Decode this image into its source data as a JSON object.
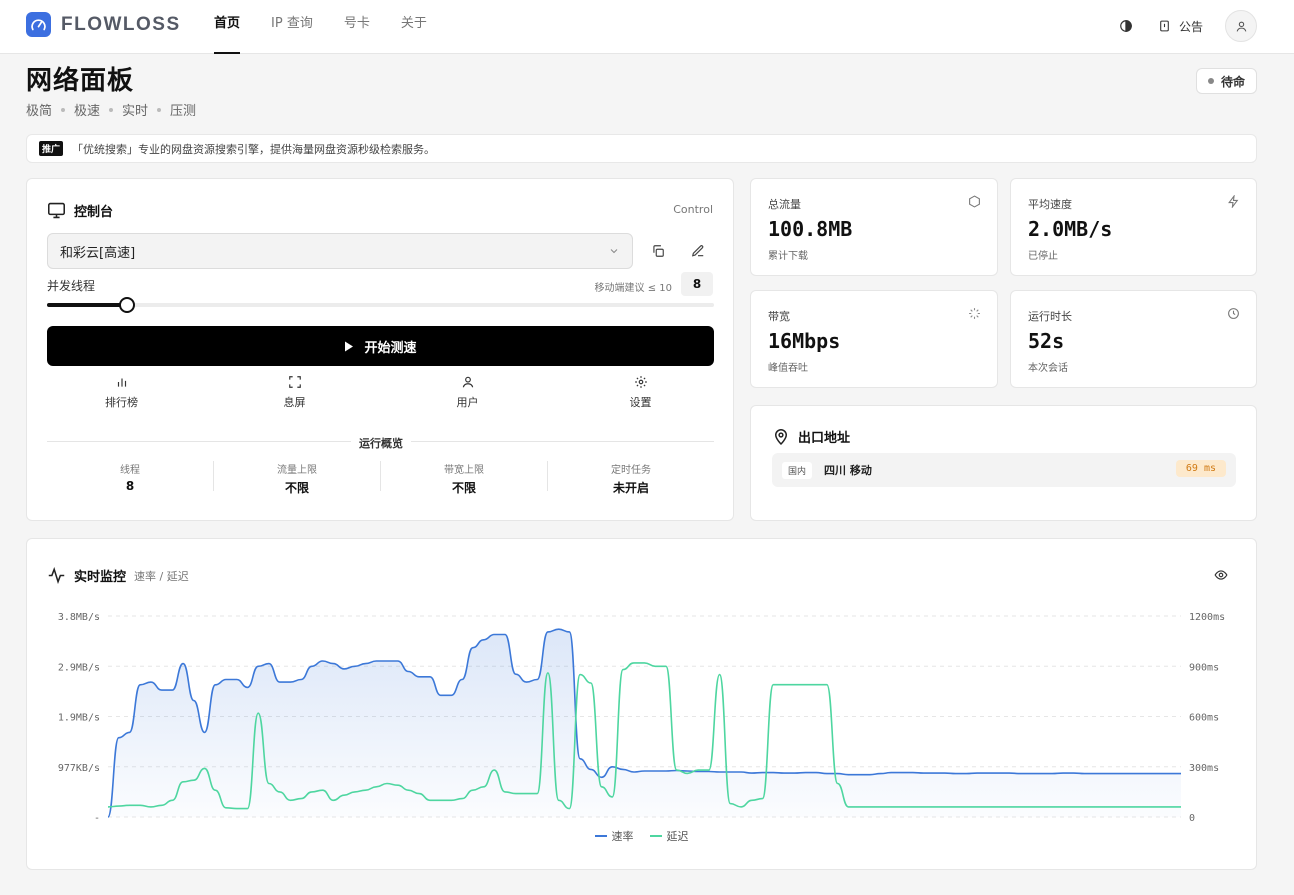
{
  "header": {
    "logo_text": "FLOWLOSS",
    "nav": [
      {
        "label": "首页",
        "active": true
      },
      {
        "label": "IP 查询",
        "active": false
      },
      {
        "label": "号卡",
        "active": false
      },
      {
        "label": "关于",
        "active": false
      }
    ],
    "notice_label": "公告"
  },
  "page": {
    "title": "网络面板",
    "tags": [
      "极简",
      "极速",
      "实时",
      "压测"
    ],
    "status": "待命"
  },
  "ad": {
    "badge": "推广",
    "text": "「优统搜索」专业的网盘资源搜索引擎，提供海量网盘资源秒级检索服务。"
  },
  "control": {
    "title": "控制台",
    "subtitle": "Control",
    "selected_node": "和彩云[高速]",
    "threads_label": "并发线程",
    "threads_hint": "移动端建议 ≤ 10",
    "threads_value": "8",
    "threads_fraction": 0.12,
    "start_label": "开始测速",
    "actions": [
      {
        "label": "排行榜",
        "icon": "chart-bars-icon"
      },
      {
        "label": "息屏",
        "icon": "fullscreen-icon"
      },
      {
        "label": "用户",
        "icon": "user-icon"
      },
      {
        "label": "设置",
        "icon": "gear-icon"
      }
    ],
    "overview_title": "运行概览",
    "overview": [
      {
        "label": "线程",
        "value": "8"
      },
      {
        "label": "流量上限",
        "value": "不限"
      },
      {
        "label": "带宽上限",
        "value": "不限"
      },
      {
        "label": "定时任务",
        "value": "未开启"
      }
    ]
  },
  "stats": [
    {
      "label": "总流量",
      "value": "100.8MB",
      "sub": "累计下载",
      "icon": "hexagon-icon"
    },
    {
      "label": "平均速度",
      "value": "2.0MB/s",
      "sub": "已停止",
      "icon": "lightning-icon"
    },
    {
      "label": "带宽",
      "value": "16Mbps",
      "sub": "峰值吞吐",
      "icon": "loader-icon"
    },
    {
      "label": "运行时长",
      "value": "52s",
      "sub": "本次会话",
      "icon": "clock-icon"
    }
  ],
  "exit": {
    "title": "出口地址",
    "region_chip": "国内",
    "location": "四川 移动",
    "latency": "69 ms"
  },
  "monitor": {
    "title": "实时监控",
    "subtitle": "速率 / 延迟",
    "legend": [
      {
        "label": "速率",
        "color": "#3c78d8"
      },
      {
        "label": "延迟",
        "color": "#4ed6a0"
      }
    ]
  },
  "chart_data": {
    "type": "line",
    "y_left_ticks": [
      "3.8MB/s",
      "2.9MB/s",
      "1.9MB/s",
      "977KB/s",
      "-"
    ],
    "y_right_ticks": [
      "1200ms",
      "900ms",
      "600ms",
      "300ms",
      "0"
    ],
    "ylim_left_MBps": [
      0,
      3.8
    ],
    "ylim_right_ms": [
      0,
      1200
    ],
    "grid": true,
    "legend_position": "bottom",
    "x": [
      0,
      1,
      2,
      3,
      4,
      5,
      6,
      7,
      8,
      9,
      10,
      11,
      12,
      13,
      14,
      15,
      16,
      17,
      18,
      19,
      20,
      21,
      22,
      23,
      24,
      25,
      26,
      27,
      28,
      29,
      30,
      31,
      32,
      33,
      34,
      35,
      36,
      37,
      38,
      39,
      40,
      41,
      42,
      43,
      44,
      45,
      46,
      47,
      48,
      49,
      50,
      51,
      52,
      53,
      54,
      55,
      56,
      57,
      58,
      59,
      60,
      61,
      62,
      63,
      64,
      65,
      66,
      67,
      68,
      69,
      70,
      71,
      72,
      73,
      74,
      75,
      76,
      77,
      78,
      79,
      80,
      81,
      82,
      83,
      84,
      85,
      86,
      87,
      88,
      89,
      90,
      91,
      92,
      93,
      94,
      95,
      96,
      97,
      98,
      99,
      100
    ],
    "series": [
      {
        "name": "速率",
        "unit": "MB/s",
        "values": [
          0,
          1.5,
          1.6,
          2.5,
          2.55,
          2.4,
          2.4,
          2.9,
          2.2,
          1.6,
          2.5,
          2.6,
          2.6,
          2.45,
          2.85,
          2.9,
          2.55,
          2.55,
          2.6,
          2.85,
          2.95,
          2.9,
          2.8,
          2.85,
          2.9,
          2.95,
          2.95,
          2.95,
          2.75,
          2.65,
          2.65,
          2.3,
          2.3,
          2.6,
          3.2,
          3.35,
          3.45,
          3.45,
          2.7,
          2.55,
          2.6,
          3.5,
          3.55,
          3.5,
          1.1,
          0.9,
          0.75,
          0.95,
          0.9,
          0.85,
          0.87,
          0.87,
          0.87,
          0.88,
          0.87,
          0.86,
          0.86,
          0.85,
          0.85,
          0.85,
          0.83,
          0.84,
          0.84,
          0.83,
          0.83,
          0.84,
          0.84,
          0.82,
          0.82,
          0.8,
          0.8,
          0.8,
          0.82,
          0.84,
          0.84,
          0.84,
          0.83,
          0.83,
          0.83,
          0.82,
          0.82,
          0.83,
          0.83,
          0.83,
          0.83,
          0.82,
          0.82,
          0.82,
          0.82,
          0.83,
          0.83,
          0.82,
          0.82,
          0.82,
          0.82,
          0.82,
          0.82,
          0.82,
          0.82,
          0.82,
          0.82
        ]
      },
      {
        "name": "延迟",
        "unit": "ms",
        "values": [
          60,
          65,
          70,
          70,
          60,
          70,
          100,
          210,
          220,
          290,
          160,
          55,
          50,
          50,
          620,
          200,
          150,
          100,
          110,
          150,
          160,
          100,
          130,
          150,
          160,
          180,
          200,
          190,
          160,
          140,
          100,
          100,
          100,
          110,
          160,
          180,
          280,
          150,
          140,
          140,
          140,
          860,
          100,
          50,
          850,
          800,
          180,
          120,
          880,
          920,
          920,
          900,
          900,
          280,
          260,
          280,
          280,
          850,
          80,
          60,
          100,
          110,
          790,
          790,
          790,
          790,
          790,
          790,
          200,
          60,
          60,
          60,
          60,
          60,
          60,
          60,
          60,
          60,
          60,
          60,
          60,
          60,
          60,
          60,
          60,
          60,
          60,
          60,
          60,
          60,
          60,
          60,
          60,
          60,
          60,
          60,
          60,
          60,
          60,
          60,
          60
        ]
      }
    ]
  }
}
